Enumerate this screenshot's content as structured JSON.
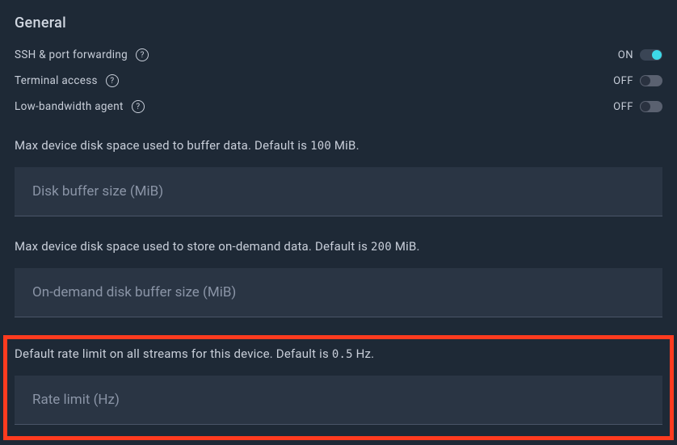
{
  "section": {
    "title": "General"
  },
  "toggles": {
    "ssh": {
      "label": "SSH & port forwarding",
      "state": "ON",
      "on": true
    },
    "terminal": {
      "label": "Terminal access",
      "state": "OFF",
      "on": false
    },
    "lowBandwidth": {
      "label": "Low-bandwidth agent",
      "state": "OFF",
      "on": false
    }
  },
  "fields": {
    "diskBuffer": {
      "description_prefix": "Max device disk space used to buffer data. Default is ",
      "description_value": "100",
      "description_suffix": " MiB.",
      "placeholder": "Disk buffer size (MiB)"
    },
    "onDemand": {
      "description_prefix": "Max device disk space used to store on-demand data. Default is ",
      "description_value": "200",
      "description_suffix": " MiB.",
      "placeholder": "On-demand disk buffer size (MiB)"
    },
    "rateLimit": {
      "description_prefix": "Default rate limit on all streams for this device. Default is ",
      "description_value": "0.5",
      "description_suffix": " Hz.",
      "placeholder": "Rate limit (Hz)"
    }
  }
}
